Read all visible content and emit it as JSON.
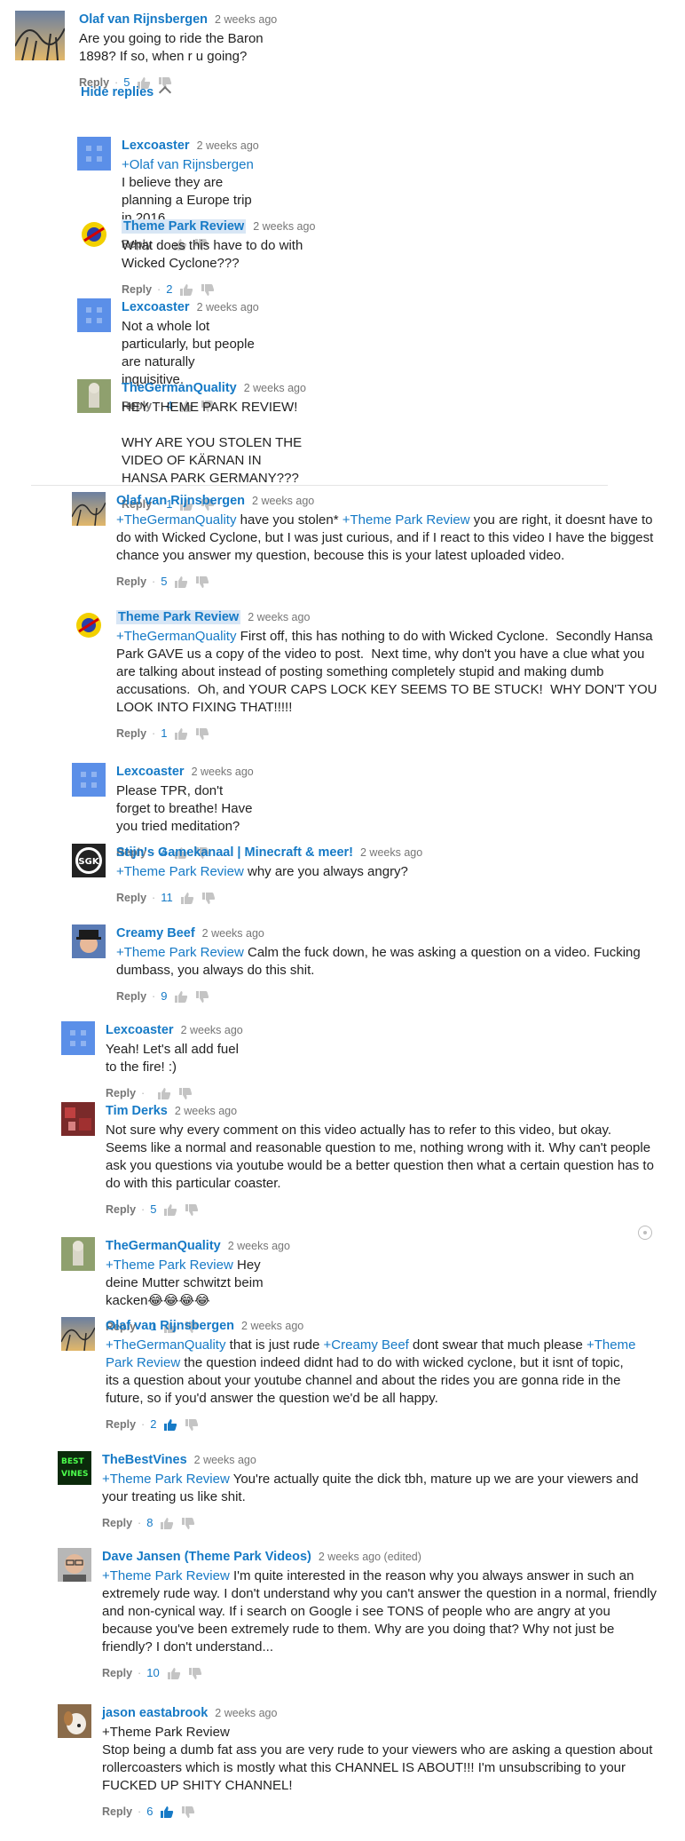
{
  "colors": {
    "link_blue": "#167ac6",
    "meta_gray": "#767676",
    "text": "#222222",
    "highlight": "#d8e6f5"
  },
  "ui": {
    "reply_label": "Reply",
    "hide_replies_label": "Hide replies"
  },
  "comments": [
    {
      "author": "Olaf van Rijnsbergen",
      "time": "2 weeks ago",
      "mention": "",
      "text": "Are you going to ride the Baron 1898? If so, when r u going?",
      "likes": "5",
      "avatar": "coaster-avatar"
    },
    {
      "author": "Lexcoaster",
      "time": "2 weeks ago",
      "mention": "+Olaf van Rijnsbergen",
      "text": " I believe they are planning a Europe trip in 2016.",
      "likes": "",
      "avatar": "blue-square-avatar"
    },
    {
      "author": "Theme Park Review",
      "time": "2 weeks ago",
      "mention": "",
      "text": "What does this have to do with Wicked Cyclone???",
      "likes": "2",
      "avatar": "tpr-logo-avatar"
    },
    {
      "author": "Lexcoaster",
      "time": "2 weeks ago",
      "mention": "",
      "text": "Not a whole lot particularly, but people are naturally inquisitive.",
      "likes": "4",
      "avatar": "blue-square-avatar"
    },
    {
      "author": "TheGermanQuality",
      "time": "2 weeks ago",
      "mention": "",
      "text": "HEY THEME PARK REVIEW!\n\nWHY ARE YOU STOLEN THE VIDEO OF KÄRNAN IN HANSA PARK GERMANY???",
      "likes": "1",
      "avatar": "statue-avatar"
    },
    {
      "author": "Olaf van Rijnsbergen",
      "time": "2 weeks ago",
      "mention": "+TheGermanQuality",
      "mention2": "+Theme Park Review",
      "text_before_m2": " have you stolen* ",
      "text": " you are right, it doesnt have to do with Wicked Cyclone, but I was just curious, and if I react to this video I have the biggest chance you answer my question, becouse this is your latest uploaded video.",
      "likes": "5",
      "avatar": "coaster-avatar"
    },
    {
      "author": "Theme Park Review",
      "time": "2 weeks ago",
      "mention": "+TheGermanQuality",
      "text": " First off, this has nothing to do with Wicked Cyclone.  Secondly Hansa Park GAVE us a copy of the video to post.  Next time, why don't you have a clue what you are talking about instead of posting something completely stupid and making dumb accusations.  Oh, and YOUR CAPS LOCK KEY SEEMS TO BE STUCK!  WHY DON'T YOU LOOK INTO FIXING THAT!!!!!",
      "likes": "1",
      "avatar": "tpr-logo-avatar"
    },
    {
      "author": "Lexcoaster",
      "time": "2 weeks ago",
      "mention": "",
      "text": "Please TPR, don't forget to breathe! Have you tried meditation?",
      "likes": "4",
      "avatar": "blue-square-avatar"
    },
    {
      "author": "Stijn's Gamekanaal | Minecraft & meer!",
      "time": "2 weeks ago",
      "mention": "+Theme Park Review",
      "text": " why are you always angry?",
      "likes": "11",
      "avatar": "sgk-avatar",
      "avatar_text": "SGK"
    },
    {
      "author": "Creamy Beef",
      "time": "2 weeks ago",
      "mention": "+Theme Park Review",
      "text": " Calm the fuck down, he was asking a question on a video. Fucking dumbass, you always do this shit.",
      "likes": "9",
      "avatar": "person-hat-avatar"
    },
    {
      "author": "Lexcoaster",
      "time": "2 weeks ago",
      "mention": "",
      "text": "Yeah! Let's all add fuel to the fire! :)",
      "likes": "",
      "avatar": "blue-square-avatar"
    },
    {
      "author": "Tim Derks",
      "time": "2 weeks ago",
      "mention": "",
      "text": "Not sure why every comment on this video actually has to refer to this video, but okay. Seems like a normal and reasonable question to me, nothing wrong with it. Why can't people ask you questions via youtube would be a better question then what a certain question has to do with this particular coaster.",
      "likes": "5",
      "avatar": "red-photo-avatar"
    },
    {
      "author": "TheGermanQuality",
      "time": "2 weeks ago",
      "mention": "+Theme Park Review",
      "text": " Hey deine Mutter schwitzt beim kacken😂😂😂😂",
      "likes": "1",
      "avatar": "statue-avatar"
    },
    {
      "author": "Olaf van Rijnsbergen",
      "time": "2 weeks ago",
      "mention": "+TheGermanQuality",
      "text_mid": " that is just rude ",
      "mention2": "+Creamy Beef",
      "text_mid2": " dont swear that much please ",
      "mention3": "+Theme Park Review",
      "text": " the question indeed didnt had to do with wicked cyclone, but it isnt of topic, its a question about your youtube channel and about the rides you are gonna ride in the future, so if you'd answer the question we'd be all happy.",
      "likes": "2",
      "avatar": "coaster-avatar"
    },
    {
      "author": "TheBestVines",
      "time": "2 weeks ago",
      "mention": "+Theme Park Review",
      "text": " You're actually quite the dick tbh, mature up we are your viewers and your treating us like shit.",
      "likes": "8",
      "avatar": "vines-avatar",
      "avatar_text": "BEST VINES"
    },
    {
      "author": "Dave Jansen (Theme Park Videos)",
      "time": "2 weeks ago (edited)",
      "mention": "+Theme Park Review",
      "text": " I'm quite interested in the reason why you always answer in such an extremely rude way. I don't understand why you can't answer the question in a normal, friendly and non-cynical way. If i search on Google i see TONS of people who are angry at you because you've been extremely rude to them. Why are you doing that? Why not just be friendly? I don't understand...",
      "likes": "10",
      "avatar": "man-glasses-avatar"
    },
    {
      "author": "jason eastabrook",
      "time": "2 weeks ago",
      "mention": "",
      "text": "+Theme Park Review\nStop being a dumb fat ass you are very rude to your viewers who are asking a question about rollercoasters which is mostly what this CHANNEL IS ABOUT!!! I'm unsubscribing to your FUCKED UP SHITY CHANNEL!",
      "likes": "6",
      "avatar": "dog-avatar"
    }
  ]
}
